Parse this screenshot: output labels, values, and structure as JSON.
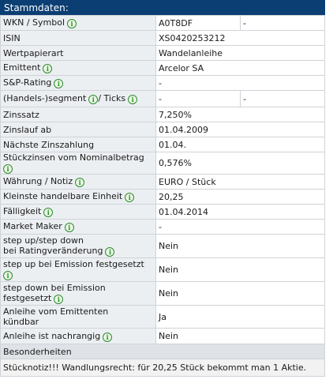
{
  "header": {
    "title": "Stammdaten:"
  },
  "rows": [
    {
      "label": "WKN / Symbol",
      "value": "A0T8DF",
      "extra": "-"
    },
    {
      "label": "ISIN",
      "value": "XS0420253212"
    },
    {
      "label": "Wertpapierart",
      "value": "Wandelanleihe"
    },
    {
      "label": "Emittent",
      "value": "Arcelor SA"
    },
    {
      "label": "S&P-Rating",
      "value": "-"
    },
    {
      "label_a": "(Handels-)segment",
      "label_b": "/ Ticks",
      "value": "-",
      "extra": "-"
    },
    {
      "label": "Zinssatz",
      "value": "7,250%"
    },
    {
      "label": "Zinslauf ab",
      "value": "01.04.2009"
    },
    {
      "label": "Nächste Zinszahlung",
      "value": "01.04."
    },
    {
      "label": "Stückzinsen vom Nominalbetrag",
      "value": "0,576%"
    },
    {
      "label": "Währung / Notiz",
      "value": "EURO / Stück"
    },
    {
      "label": "Kleinste handelbare Einheit",
      "value": "20,25"
    },
    {
      "label": "Fälligkeit",
      "value": "01.04.2014"
    },
    {
      "label": "Market Maker",
      "value": "-"
    },
    {
      "label_1": "step up/step down",
      "label_2": "bei Ratingveränderung",
      "value": "Nein"
    },
    {
      "label": "step up bei Emission festgesetzt",
      "value": "Nein"
    },
    {
      "label_1": "step down bei Emission",
      "label_2": "festgesetzt",
      "value": "Nein"
    },
    {
      "label_1": "Anleihe vom Emittenten",
      "label_2": "kündbar",
      "value": "Ja"
    },
    {
      "label": "Anleihe ist nachrangig",
      "value": "Nein"
    }
  ],
  "besonderheiten": {
    "title": "Besonderheiten",
    "text": "Stücknotiz!!! Wandlungsrecht: für 20,25 Stück bekommt man 1 Aktie."
  },
  "icons": {
    "info": "info-icon",
    "info_color": "#2e8b2e",
    "header_color": "#0b3f73"
  }
}
